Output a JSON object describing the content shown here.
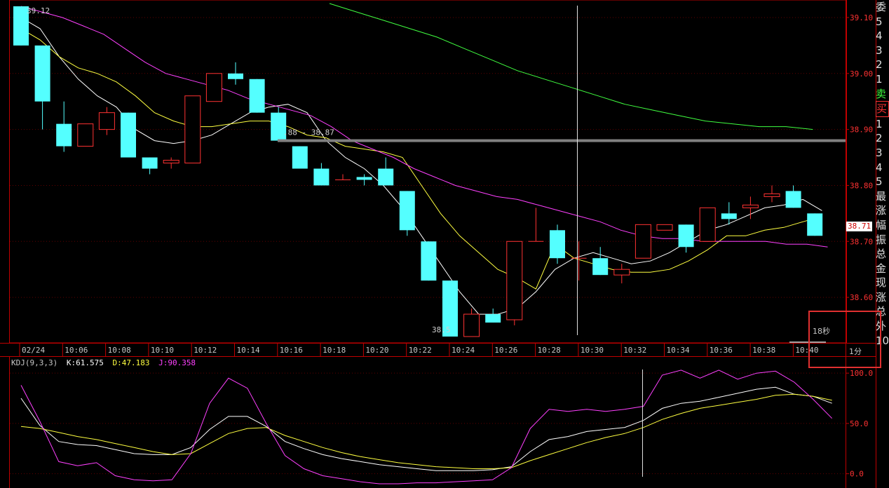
{
  "chart_data": [
    {
      "type": "candlestick",
      "price_ticks": [
        "39.10",
        "39.00",
        "38.90",
        "38.80",
        "38.70",
        "38.60"
      ],
      "time_ticks": [
        "02/24",
        "10:06",
        "10:08",
        "10:10",
        "10:12",
        "10:14",
        "10:16",
        "10:18",
        "10:20",
        "10:22",
        "10:24",
        "10:26",
        "10:28",
        "10:30",
        "10:32",
        "10:34",
        "10:36",
        "10:38",
        "10:40"
      ],
      "ylim": [
        38.53,
        39.125
      ],
      "high_label": "39.12",
      "low_label": "38.5",
      "last_price": "38.71",
      "range_label": ".88 - 38.87",
      "range_band": [
        38.87,
        38.88
      ],
      "candles": [
        {
          "o": 39.12,
          "c": 39.05,
          "h": 39.12,
          "l": 39.05
        },
        {
          "o": 39.05,
          "c": 38.95,
          "h": 39.05,
          "l": 38.9
        },
        {
          "o": 38.91,
          "c": 38.87,
          "h": 38.95,
          "l": 38.86
        },
        {
          "o": 38.87,
          "c": 38.91,
          "h": 38.91,
          "l": 38.87
        },
        {
          "o": 38.9,
          "c": 38.93,
          "h": 38.94,
          "l": 38.89
        },
        {
          "o": 38.93,
          "c": 38.85,
          "h": 38.93,
          "l": 38.85
        },
        {
          "o": 38.85,
          "c": 38.83,
          "h": 38.85,
          "l": 38.82
        },
        {
          "o": 38.84,
          "c": 38.845,
          "h": 38.85,
          "l": 38.83
        },
        {
          "o": 38.84,
          "c": 38.96,
          "h": 38.96,
          "l": 38.84
        },
        {
          "o": 38.95,
          "c": 39.0,
          "h": 39.0,
          "l": 38.95
        },
        {
          "o": 39.0,
          "c": 38.99,
          "h": 39.02,
          "l": 38.98
        },
        {
          "o": 38.99,
          "c": 38.93,
          "h": 38.99,
          "l": 38.93
        },
        {
          "o": 38.93,
          "c": 38.88,
          "h": 38.94,
          "l": 38.88
        },
        {
          "o": 38.87,
          "c": 38.83,
          "h": 38.87,
          "l": 38.83
        },
        {
          "o": 38.83,
          "c": 38.8,
          "h": 38.84,
          "l": 38.8
        },
        {
          "o": 38.81,
          "c": 38.81,
          "h": 38.82,
          "l": 38.81
        },
        {
          "o": 38.815,
          "c": 38.81,
          "h": 38.82,
          "l": 38.8
        },
        {
          "o": 38.83,
          "c": 38.8,
          "h": 38.85,
          "l": 38.8
        },
        {
          "o": 38.79,
          "c": 38.72,
          "h": 38.79,
          "l": 38.71
        },
        {
          "o": 38.7,
          "c": 38.63,
          "h": 38.7,
          "l": 38.63
        },
        {
          "o": 38.63,
          "c": 38.53,
          "h": 38.63,
          "l": 38.53
        },
        {
          "o": 38.53,
          "c": 38.57,
          "h": 38.58,
          "l": 38.53
        },
        {
          "o": 38.57,
          "c": 38.555,
          "h": 38.58,
          "l": 38.555
        },
        {
          "o": 38.56,
          "c": 38.7,
          "h": 38.7,
          "l": 38.55
        },
        {
          "o": 38.7,
          "c": 38.7,
          "h": 38.76,
          "l": 38.7
        },
        {
          "o": 38.72,
          "c": 38.67,
          "h": 38.73,
          "l": 38.66
        },
        {
          "o": 38.67,
          "c": 38.67,
          "h": 38.7,
          "l": 38.63
        },
        {
          "o": 38.67,
          "c": 38.64,
          "h": 38.69,
          "l": 38.64
        },
        {
          "o": 38.64,
          "c": 38.65,
          "h": 38.66,
          "l": 38.625
        },
        {
          "o": 38.67,
          "c": 38.73,
          "h": 38.73,
          "l": 38.67
        },
        {
          "o": 38.72,
          "c": 38.73,
          "h": 38.73,
          "l": 38.72
        },
        {
          "o": 38.73,
          "c": 38.69,
          "h": 38.73,
          "l": 38.68
        },
        {
          "o": 38.7,
          "c": 38.76,
          "h": 38.76,
          "l": 38.7
        },
        {
          "o": 38.75,
          "c": 38.74,
          "h": 38.77,
          "l": 38.73
        },
        {
          "o": 38.76,
          "c": 38.765,
          "h": 38.78,
          "l": 38.74
        },
        {
          "o": 38.78,
          "c": 38.785,
          "h": 38.8,
          "l": 38.77
        },
        {
          "o": 38.79,
          "c": 38.76,
          "h": 38.8,
          "l": 38.76
        },
        {
          "o": 38.75,
          "c": 38.71,
          "h": 38.75,
          "l": 38.71
        }
      ],
      "ma_fast": [
        39.1,
        39.08,
        39.03,
        38.99,
        38.96,
        38.94,
        38.9,
        38.88,
        38.875,
        38.88,
        38.89,
        38.91,
        38.93,
        38.94,
        38.945,
        38.93,
        38.88,
        38.85,
        38.83,
        38.8,
        38.76,
        38.71,
        38.66,
        38.61,
        38.57,
        38.57,
        38.58,
        38.61,
        38.65,
        38.67,
        38.68,
        38.67,
        38.66,
        38.665,
        38.68,
        38.7,
        38.72,
        38.73,
        38.745,
        38.76,
        38.765,
        38.775,
        38.755
      ],
      "ma_mid": [
        39.08,
        39.06,
        39.03,
        39.01,
        39.0,
        38.985,
        38.96,
        38.93,
        38.915,
        38.905,
        38.905,
        38.91,
        38.915,
        38.915,
        38.905,
        38.89,
        38.885,
        38.87,
        38.865,
        38.86,
        38.85,
        38.8,
        38.75,
        38.71,
        38.68,
        38.65,
        38.635,
        38.615,
        38.695,
        38.67,
        38.66,
        38.65,
        38.645,
        38.645,
        38.65,
        38.665,
        38.685,
        38.71,
        38.71,
        38.72,
        38.725,
        38.735,
        38.745
      ],
      "ma_slow": [
        39.12,
        39.11,
        39.1,
        39.085,
        39.07,
        39.045,
        39.02,
        39.0,
        38.99,
        38.98,
        38.97,
        38.955,
        38.945,
        38.935,
        38.925,
        38.905,
        38.88,
        38.865,
        38.85,
        38.83,
        38.815,
        38.8,
        38.79,
        38.78,
        38.775,
        38.765,
        38.755,
        38.745,
        38.735,
        38.72,
        38.71,
        38.705,
        38.705,
        38.7,
        38.7,
        38.7,
        38.7,
        38.695,
        38.695,
        38.69
      ],
      "ma_long": [
        39.125,
        39.11,
        39.095,
        39.08,
        39.065,
        39.045,
        39.025,
        39.005,
        38.99,
        38.975,
        38.96,
        38.945,
        38.935,
        38.925,
        38.915,
        38.91,
        38.905,
        38.905,
        38.9
      ]
    },
    {
      "type": "line",
      "indicator": "KDJ(9,3,3)",
      "ylim": [
        -10,
        105
      ],
      "ticks": [
        "100.0",
        "50.0",
        "0.0"
      ],
      "k_label": "K:61.575",
      "d_label": "D:47.183",
      "j_label": "J:90.358",
      "series": [
        {
          "name": "K",
          "values": [
            75,
            48,
            32,
            29,
            28,
            24,
            20,
            19,
            19,
            26,
            44,
            57,
            57,
            47,
            32,
            25,
            19,
            15,
            12,
            9,
            7,
            5,
            3,
            3,
            3,
            4,
            7,
            22,
            34,
            37,
            42,
            44,
            46,
            53,
            65,
            70,
            72,
            76,
            80,
            84,
            86,
            79,
            77,
            70
          ]
        },
        {
          "name": "D",
          "values": [
            47,
            45,
            41,
            37,
            34,
            30,
            26,
            22,
            19,
            20,
            30,
            40,
            45,
            46,
            38,
            32,
            26,
            21,
            17,
            14,
            11,
            9,
            7,
            6,
            5,
            5,
            6,
            13,
            19,
            25,
            31,
            36,
            40,
            46,
            54,
            60,
            65,
            68,
            71,
            74,
            78,
            79,
            77,
            73
          ]
        },
        {
          "name": "J",
          "values": [
            88,
            52,
            12,
            8,
            11,
            -2,
            -6,
            -7,
            -6,
            20,
            70,
            95,
            85,
            50,
            18,
            5,
            -2,
            -5,
            -8,
            -10,
            -10,
            -9,
            -9,
            -8,
            -7,
            -6,
            6,
            45,
            64,
            62,
            64,
            62,
            64,
            67,
            98,
            103,
            95,
            103,
            94,
            100,
            102,
            91,
            74,
            55
          ]
        }
      ]
    }
  ],
  "kdj_header": {
    "name": "KDJ(9,3,3)",
    "k": "K:61.575",
    "d": "D:47.183",
    "j": "J:90.358"
  },
  "timeframe_label": "18秒",
  "period_label": "1分",
  "side_panel": [
    "委",
    "5",
    "4",
    "3",
    "2",
    "1",
    "卖",
    "买",
    "1",
    "2",
    "3",
    "4",
    "5",
    "最",
    "涨",
    "幅",
    "振",
    "总",
    "金",
    "现",
    "涨",
    "总",
    "外",
    "10:"
  ],
  "colors": {
    "up": "#ff3232",
    "down": "#54ffff",
    "ma_fast": "#ffffff",
    "ma_mid": "#ffff40",
    "ma_slow": "#ff40ff",
    "ma_long": "#40ff40",
    "axis": "#c00000",
    "band": "#808080"
  }
}
